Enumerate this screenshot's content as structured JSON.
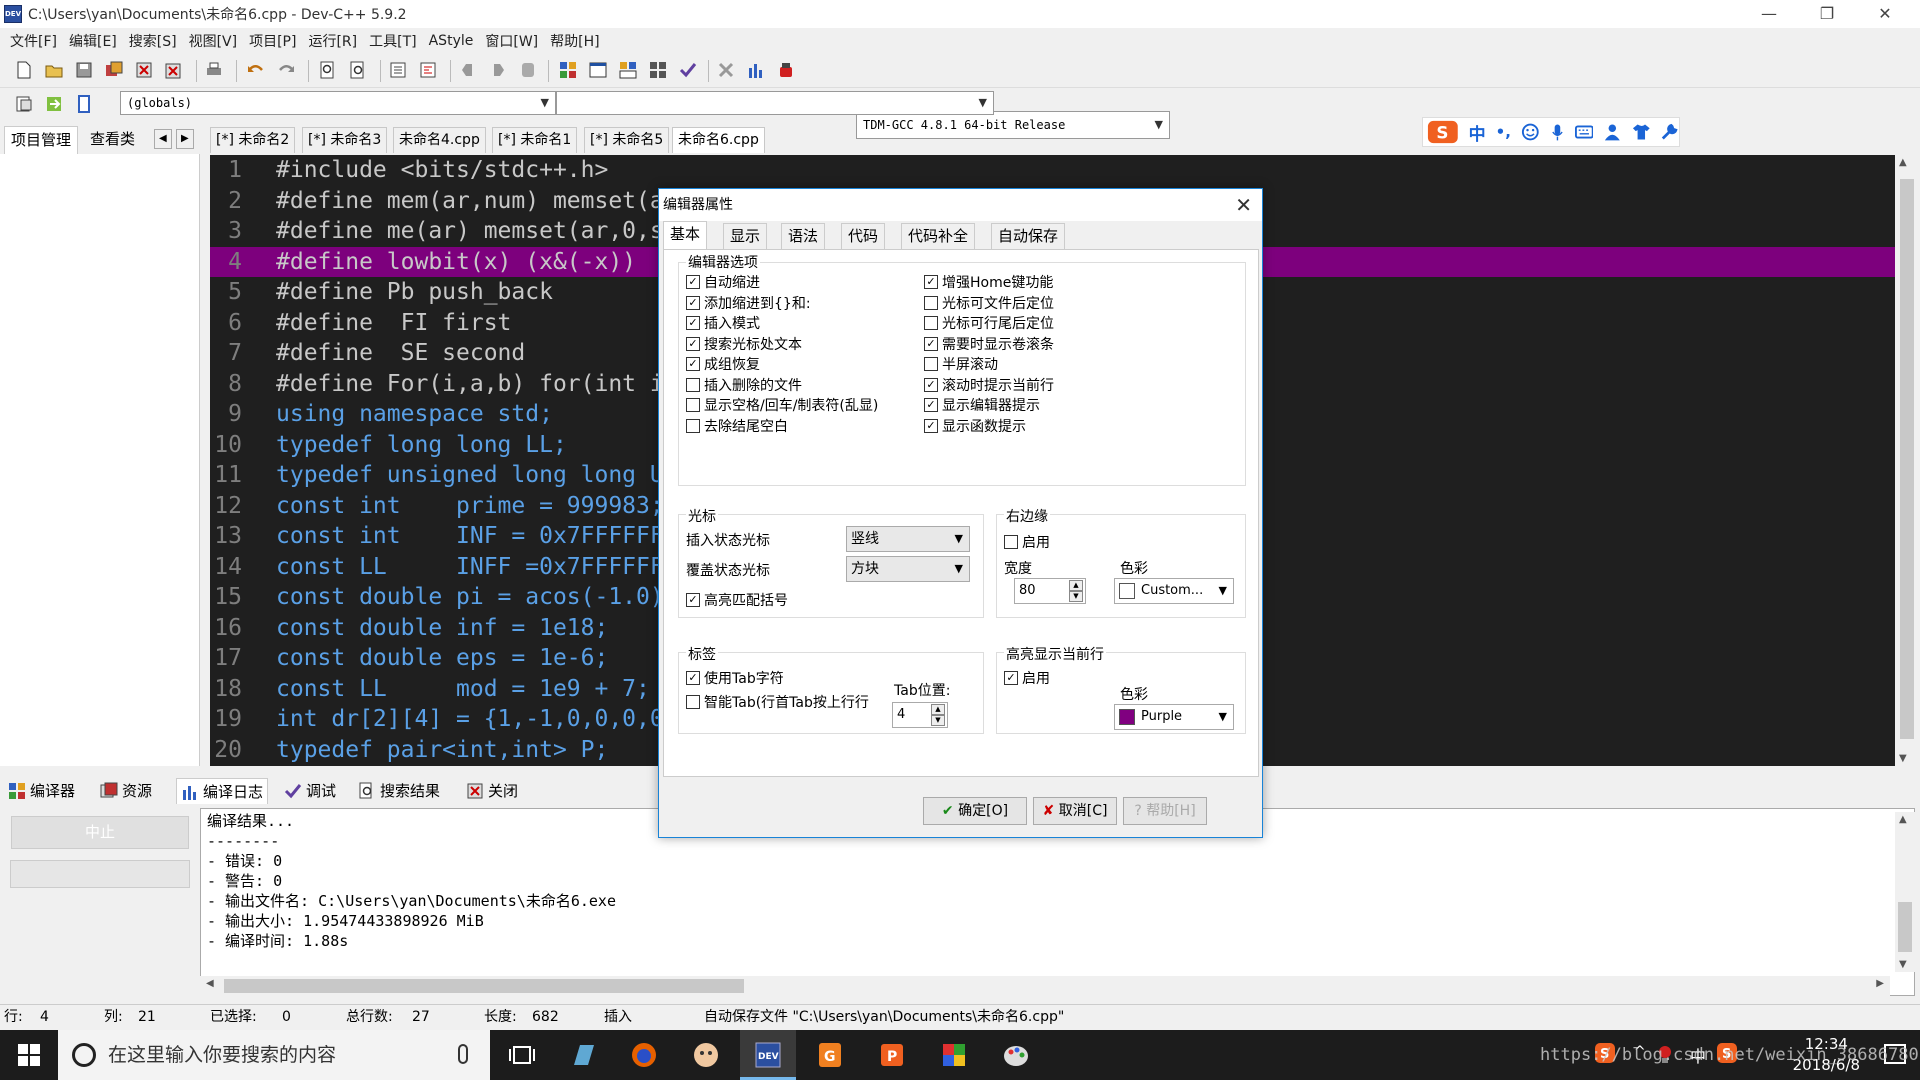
{
  "window": {
    "title": "C:\\Users\\yan\\Documents\\未命名6.cpp - Dev-C++ 5.9.2",
    "app_icon_text": "DEV",
    "controls": {
      "minimize": "—",
      "restore": "❐",
      "close": "✕"
    }
  },
  "menu": [
    "文件[F]",
    "编辑[E]",
    "搜索[S]",
    "视图[V]",
    "项目[P]",
    "运行[R]",
    "工具[T]",
    "AStyle",
    "窗口[W]",
    "帮助[H]"
  ],
  "toolbar": {
    "compiler_select": "TDM-GCC 4.8.1 64-bit Release",
    "scope_select": "(globals)",
    "function_select": ""
  },
  "left_tabs": [
    "项目管理",
    "查看类"
  ],
  "file_tabs": [
    "[*] 未命名2",
    "[*] 未命名3",
    "未命名4.cpp",
    "[*] 未命名1",
    "[*] 未命名5",
    "未命名6.cpp"
  ],
  "ime_bar": {
    "mode": "中",
    "punct": "•,"
  },
  "editor": {
    "lines": [
      {
        "n": "1",
        "text": "#include <bits/stdc++.h>",
        "cls": "pp"
      },
      {
        "n": "2",
        "text": "#define mem(ar,num) memset(ar,num,sizeof(ar))",
        "cls": "pp"
      },
      {
        "n": "3",
        "text": "#define me(ar) memset(ar,0,sizeof(ar))",
        "cls": "pp"
      },
      {
        "n": "4",
        "text": "#define lowbit(x) (x&(-x))",
        "cls": "pp",
        "hl": true
      },
      {
        "n": "5",
        "text": "#define Pb push_back",
        "cls": "pp"
      },
      {
        "n": "6",
        "text": "#define  FI first",
        "cls": "pp"
      },
      {
        "n": "7",
        "text": "#define  SE second",
        "cls": "pp"
      },
      {
        "n": "8",
        "text": "#define For(i,a,b) for(int i=a;i<b;++i)",
        "cls": "pp"
      },
      {
        "n": "9",
        "text": "using namespace std;",
        "cls": "kw"
      },
      {
        "n": "10",
        "text": "typedef long long LL;",
        "cls": "kw"
      },
      {
        "n": "11",
        "text": "typedef unsigned long long ULL;",
        "cls": "kw"
      },
      {
        "n": "12",
        "text": "const int    prime = 999983;",
        "cls": "kw"
      },
      {
        "n": "13",
        "text": "const int    INF = 0x7FFFFFFF;",
        "cls": "kw"
      },
      {
        "n": "14",
        "text": "const LL     INFF =0x7FFFFFFFFFFFFFFF;",
        "cls": "kw"
      },
      {
        "n": "15",
        "text": "const double pi = acos(-1.0);",
        "cls": "kw"
      },
      {
        "n": "16",
        "text": "const double inf = 1e18;",
        "cls": "kw"
      },
      {
        "n": "17",
        "text": "const double eps = 1e-6;",
        "cls": "kw"
      },
      {
        "n": "18",
        "text": "const LL     mod = 1e9 + 7;",
        "cls": "kw"
      },
      {
        "n": "19",
        "text": "int dr[2][4] = {1,-1,0,0,0,0,-1,1};",
        "cls": "kw"
      },
      {
        "n": "20",
        "text": "typedef pair<int,int> P;",
        "cls": "kw"
      }
    ]
  },
  "bottom_tabs": [
    "编译器",
    "资源",
    "编译日志",
    "调试",
    "搜索结果",
    "关闭"
  ],
  "bottom": {
    "stop_button": "中止",
    "output_lines": [
      "编译结果...",
      "--------",
      "- 错误: 0",
      "- 警告: 0",
      "- 输出文件名: C:\\Users\\yan\\Documents\\未命名6.exe",
      "- 输出大小: 1.95474433898926 MiB",
      "- 编译时间: 1.88s"
    ]
  },
  "status": {
    "row_label": "行:",
    "row": "4",
    "col_label": "列:",
    "col": "21",
    "sel_label": "已选择:",
    "sel": "0",
    "lines_label": "总行数:",
    "lines": "27",
    "len_label": "长度:",
    "len": "682",
    "mode": "插入",
    "autosave": "自动保存文件 \"C:\\Users\\yan\\Documents\\未命名6.cpp\""
  },
  "dialog": {
    "title": "编辑器属性",
    "tabs": [
      "基本",
      "显示",
      "语法",
      "代码",
      "代码补全",
      "自动保存"
    ],
    "options_group": "编辑器选项",
    "left_options": [
      {
        "label": "自动缩进",
        "checked": true
      },
      {
        "label": "添加缩进到{}和:",
        "checked": true
      },
      {
        "label": "插入模式",
        "checked": true
      },
      {
        "label": "搜索光标处文本",
        "checked": true
      },
      {
        "label": "成组恢复",
        "checked": true
      },
      {
        "label": "插入删除的文件",
        "checked": false
      },
      {
        "label": "显示空格/回车/制表符(乱显)",
        "checked": false
      },
      {
        "label": "去除结尾空白",
        "checked": false
      }
    ],
    "right_options": [
      {
        "label": "增强Home键功能",
        "checked": true
      },
      {
        "label": "光标可文件后定位",
        "checked": false
      },
      {
        "label": "光标可行尾后定位",
        "checked": false
      },
      {
        "label": "需要时显示卷滚条",
        "checked": true
      },
      {
        "label": "半屏滚动",
        "checked": false
      },
      {
        "label": "滚动时提示当前行",
        "checked": true
      },
      {
        "label": "显示编辑器提示",
        "checked": true
      },
      {
        "label": "显示函数提示",
        "checked": true
      }
    ],
    "caret": {
      "group": "光标",
      "insert_label": "插入状态光标",
      "insert_value": "竖线",
      "overwrite_label": "覆盖状态光标",
      "overwrite_value": "方块",
      "match_label": "高亮匹配括号",
      "match_checked": true
    },
    "margin": {
      "group": "右边缘",
      "enable_label": "启用",
      "enable_checked": false,
      "width_label": "宽度",
      "width": "80",
      "color_label": "色彩",
      "color_name": "Custom...",
      "color": "#ffffff"
    },
    "tabs_group": {
      "group": "标签",
      "use_tab_label": "使用Tab字符",
      "use_tab_checked": true,
      "smart_tab_label": "智能Tab(行首Tab按上行行",
      "smart_tab_checked": false,
      "tab_pos_label": "Tab位置:",
      "tab_pos": "4"
    },
    "highlight": {
      "group": "高亮显示当前行",
      "enable_label": "启用",
      "enable_checked": true,
      "color_label": "色彩",
      "color_name": "Purple",
      "color": "#800080"
    },
    "buttons": {
      "ok": "确定[O]",
      "cancel": "取消[C]",
      "help": "帮助[H]"
    }
  },
  "taskbar": {
    "search_placeholder": "在这里输入你要搜索的内容",
    "time": "12:34",
    "date": "2018/6/8",
    "ime": "中",
    "watermark": "https://blog.csdn.net/weixin_38686780"
  }
}
